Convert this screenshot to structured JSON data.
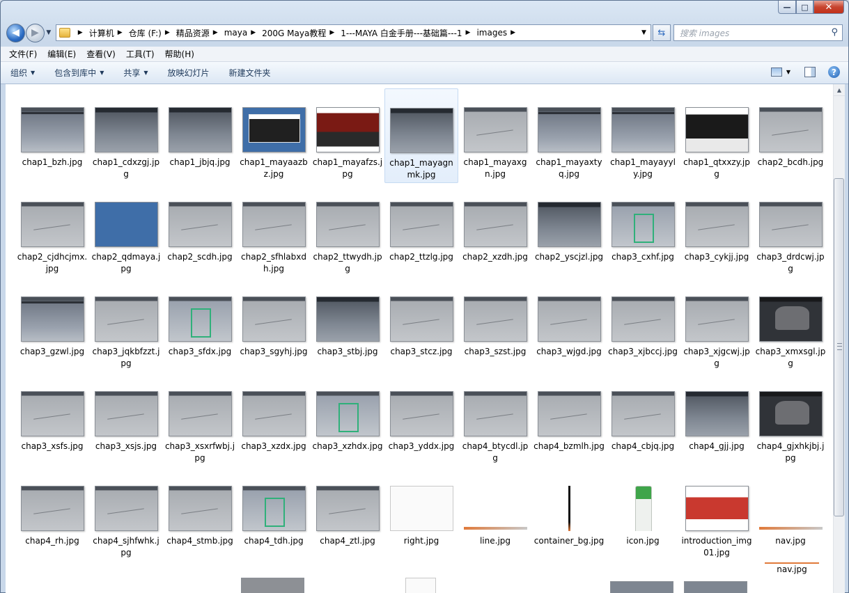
{
  "window": {
    "controls": {
      "minimize": "—",
      "maximize": "□",
      "close": "✕"
    }
  },
  "address": {
    "crumbs": [
      "计算机",
      "仓库 (F:)",
      "精品资源",
      "maya",
      "200G Maya教程",
      "1---MAYA 白金手册---基础篇---1",
      "images"
    ],
    "dropdown_icon": "chevron-down-icon"
  },
  "search": {
    "placeholder": "搜索 images",
    "icon": "search-icon"
  },
  "menu": [
    "文件(F)",
    "编辑(E)",
    "查看(V)",
    "工具(T)",
    "帮助(H)"
  ],
  "commands": [
    {
      "label": "组织",
      "dropdown": true
    },
    {
      "label": "包含到库中",
      "dropdown": true
    },
    {
      "label": "共享",
      "dropdown": true
    },
    {
      "label": "放映幻灯片",
      "dropdown": false
    },
    {
      "label": "新建文件夹",
      "dropdown": false
    }
  ],
  "files": [
    {
      "name": "chap1_bzh.jpg",
      "style": "t-maya"
    },
    {
      "name": "chap1_cdxzgj.jpg",
      "style": "t-dark"
    },
    {
      "name": "chap1_jbjq.jpg",
      "style": "t-dark"
    },
    {
      "name": "chap1_mayaazbz.jpg",
      "style": "t-blueweb"
    },
    {
      "name": "chap1_mayafzs.jpg",
      "style": "t-red"
    },
    {
      "name": "chap1_mayagnmk.jpg",
      "style": "t-dark",
      "selected": true
    },
    {
      "name": "chap1_mayaxgn.jpg",
      "style": "t-grid"
    },
    {
      "name": "chap1_mayaxtyq.jpg",
      "style": "t-maya"
    },
    {
      "name": "chap1_mayayyly.jpg",
      "style": "t-maya"
    },
    {
      "name": "chap1_qtxxzy.jpg",
      "style": "t-web"
    },
    {
      "name": "chap2_bcdh.jpg",
      "style": "t-grid"
    },
    {
      "name": "chap2_cjdhcjmx.jpg",
      "style": "t-grid"
    },
    {
      "name": "chap2_qdmaya.jpg",
      "style": "t-blue"
    },
    {
      "name": "chap2_scdh.jpg",
      "style": "t-grid"
    },
    {
      "name": "chap2_sfhlabxdh.jpg",
      "style": "t-grid"
    },
    {
      "name": "chap2_ttwydh.jpg",
      "style": "t-grid"
    },
    {
      "name": "chap2_ttzlg.jpg",
      "style": "t-grid"
    },
    {
      "name": "chap2_xzdh.jpg",
      "style": "t-grid"
    },
    {
      "name": "chap2_yscjzl.jpg",
      "style": "t-dark"
    },
    {
      "name": "chap3_cxhf.jpg",
      "style": "t-green"
    },
    {
      "name": "chap3_cykjj.jpg",
      "style": "t-grid"
    },
    {
      "name": "chap3_drdcwj.jpg",
      "style": "t-grid"
    },
    {
      "name": "chap3_gzwl.jpg",
      "style": "t-maya"
    },
    {
      "name": "chap3_jqkbfzzt.jpg",
      "style": "t-grid"
    },
    {
      "name": "chap3_sfdx.jpg",
      "style": "t-green"
    },
    {
      "name": "chap3_sgyhj.jpg",
      "style": "t-grid"
    },
    {
      "name": "chap3_stbj.jpg",
      "style": "t-dark"
    },
    {
      "name": "chap3_stcz.jpg",
      "style": "t-grid"
    },
    {
      "name": "chap3_szst.jpg",
      "style": "t-grid"
    },
    {
      "name": "chap3_wjgd.jpg",
      "style": "t-grid"
    },
    {
      "name": "chap3_xjbccj.jpg",
      "style": "t-grid"
    },
    {
      "name": "chap3_xjgcwj.jpg",
      "style": "t-grid"
    },
    {
      "name": "chap3_xmxsgl.jpg",
      "style": "t-dark2"
    },
    {
      "name": "chap3_xsfs.jpg",
      "style": "t-grid"
    },
    {
      "name": "chap3_xsjs.jpg",
      "style": "t-grid"
    },
    {
      "name": "chap3_xsxrfwbj.jpg",
      "style": "t-grid"
    },
    {
      "name": "chap3_xzdx.jpg",
      "style": "t-grid"
    },
    {
      "name": "chap3_xzhdx.jpg",
      "style": "t-green"
    },
    {
      "name": "chap3_yddx.jpg",
      "style": "t-grid"
    },
    {
      "name": "chap4_btycdl.jpg",
      "style": "t-grid"
    },
    {
      "name": "chap4_bzmlh.jpg",
      "style": "t-grid"
    },
    {
      "name": "chap4_cbjq.jpg",
      "style": "t-grid"
    },
    {
      "name": "chap4_gjj.jpg",
      "style": "t-dark"
    },
    {
      "name": "chap4_gjxhkjbj.jpg",
      "style": "t-dark2"
    },
    {
      "name": "chap4_rh.jpg",
      "style": "t-grid"
    },
    {
      "name": "chap4_sjhfwhk.jpg",
      "style": "t-grid"
    },
    {
      "name": "chap4_stmb.jpg",
      "style": "t-grid"
    },
    {
      "name": "chap4_tdh.jpg",
      "style": "t-green"
    },
    {
      "name": "chap4_ztl.jpg",
      "style": "t-grid"
    },
    {
      "name": "right.jpg",
      "style": "t-white"
    },
    {
      "name": "line.jpg",
      "style": "t-nav"
    },
    {
      "name": "container_bg.jpg",
      "style": "t-stick"
    },
    {
      "name": "icon.jpg",
      "style": "t-icon"
    },
    {
      "name": "introduction_img01.jpg",
      "style": "t-books"
    },
    {
      "name": "nav.jpg",
      "style": "t-nav"
    }
  ],
  "partial_last": {
    "name": "nav.jpg"
  }
}
